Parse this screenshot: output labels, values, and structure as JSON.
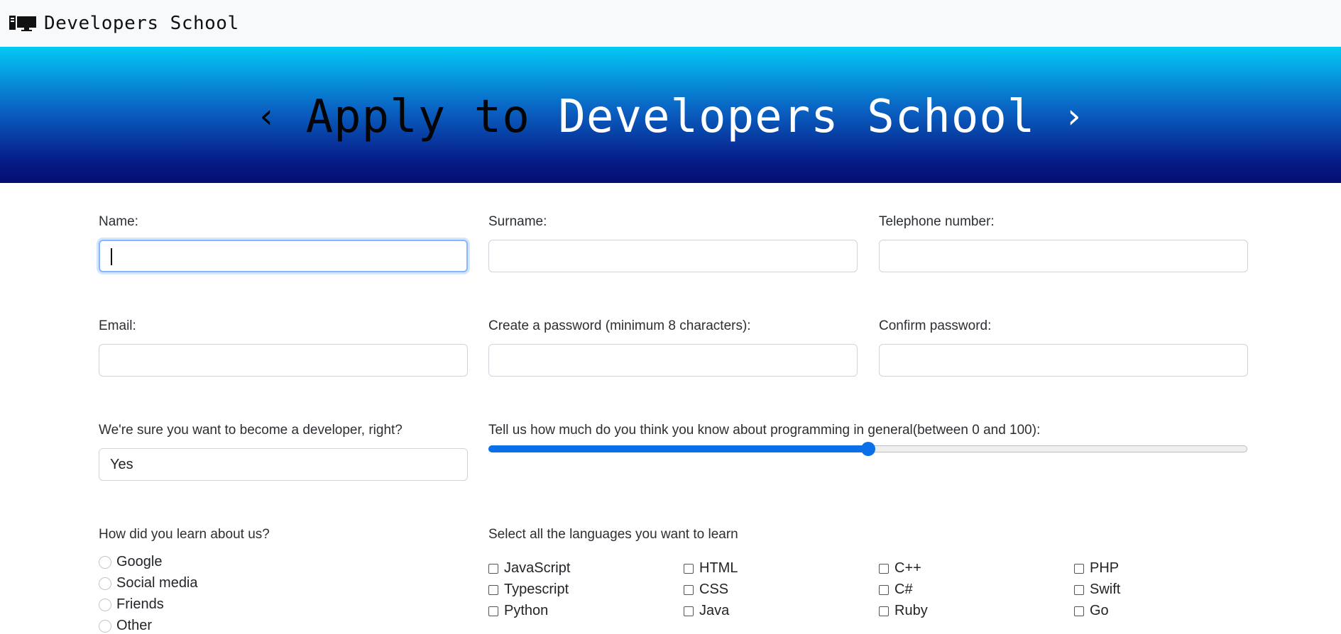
{
  "navbar": {
    "brand": "Developers School",
    "brand_icon": "computer-icon"
  },
  "hero": {
    "chev_left": "‹",
    "title_dark": "Apply to",
    "title_light": "Developers School",
    "chev_right": "›"
  },
  "form": {
    "name_label": "Name:",
    "surname_label": "Surname:",
    "telephone_label": "Telephone number:",
    "email_label": "Email:",
    "password_label": "Create a password (minimum 8 characters):",
    "confirm_label": "Confirm password:",
    "developer_label": "We're sure you want to become a developer, right?",
    "developer_value": "Yes",
    "knowledge_label": "Tell us how much do you think you know about programming in general(between 0 and 100):",
    "knowledge_value": 50,
    "knowledge_min": 0,
    "knowledge_max": 100,
    "learn_label": "How did you learn about us?",
    "learn_options": [
      "Google",
      "Social media",
      "Friends",
      "Other"
    ],
    "languages_label": "Select all the languages you want to learn",
    "languages": [
      [
        "JavaScript",
        "HTML",
        "C++",
        "PHP"
      ],
      [
        "Typescript",
        "CSS",
        "C#",
        "Swift"
      ],
      [
        "Python",
        "Java",
        "Ruby",
        "Go"
      ]
    ]
  },
  "colors": {
    "accent": "#0b6fe8",
    "hero_top": "#03c9f5",
    "hero_bottom": "#050e72",
    "navbar_bg": "#f8f9fa"
  }
}
